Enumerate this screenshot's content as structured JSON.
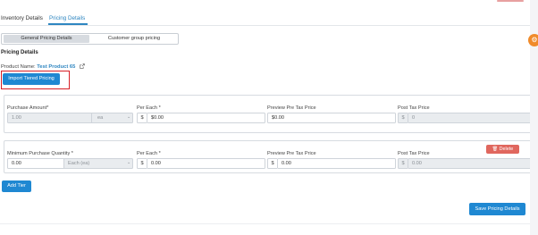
{
  "tabs": [
    {
      "label": "Inventory Details",
      "active": false
    },
    {
      "label": "Pricing Details",
      "active": true
    }
  ],
  "segment": {
    "options": [
      "General Pricing Details",
      "Customer group pricing"
    ],
    "selected": "General Pricing Details"
  },
  "section_title": "Pricing Details",
  "product": {
    "label": "Product Name:",
    "name": "Test Product 65",
    "link_icon": "external-link-icon"
  },
  "buttons": {
    "import": "Import Tiered Pricing",
    "delete": "Delete",
    "add_tier": "Add Tier",
    "save": "Save Pricing Details"
  },
  "base_row": {
    "amount_label": "Purchase Amount*",
    "amount_value": "1.00",
    "unit_value": "ea",
    "per_each_label": "Per Each *",
    "per_each_value": "$0.00",
    "preview_label": "Preview Pre Tax Price",
    "preview_value": "$0.00",
    "post_tax_label": "Post Tax Price",
    "post_tax_value": "0",
    "currency": "$"
  },
  "tier_row": {
    "min_qty_label": "Minimum Purchase Quantity *",
    "min_qty_value": "0.00",
    "unit_value": "Each (ea)",
    "per_each_label": "Per Each *",
    "per_each_value": "0.00",
    "preview_label": "Preview Pre Tax Price",
    "preview_value": "0.00",
    "post_tax_label": "Post Tax Price",
    "post_tax_value": "0.00",
    "currency": "$"
  },
  "colors": {
    "primary": "#1f88d2",
    "danger": "#e0675e",
    "highlight_box": "#d81f26",
    "fab": "#f08b2b"
  }
}
